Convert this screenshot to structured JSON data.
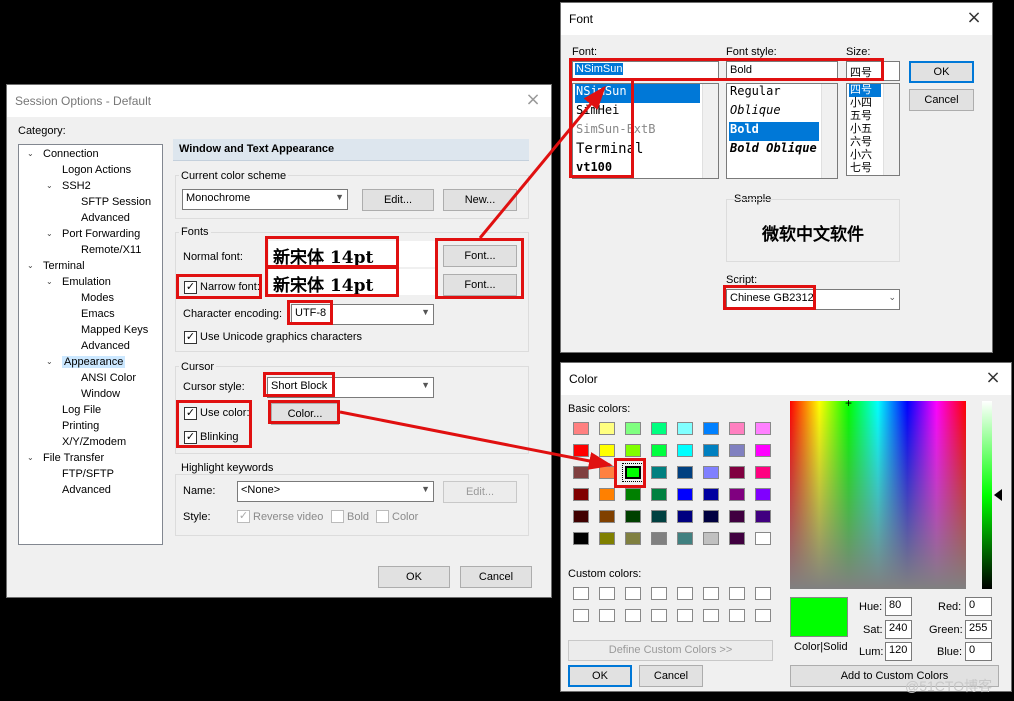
{
  "session": {
    "title": "Session Options - Default",
    "category_label": "Category:",
    "tree": [
      {
        "label": "Connection",
        "exp": "⌄",
        "expand": true
      },
      {
        "label": "Logon Actions"
      },
      {
        "label": "SSH2",
        "exp": "⌄",
        "expand": true
      },
      {
        "label": "SFTP Session"
      },
      {
        "label": "Advanced"
      },
      {
        "label": "Port Forwarding",
        "exp": "⌄",
        "expand": true
      },
      {
        "label": "Remote/X11"
      },
      {
        "label": "Terminal",
        "exp": "⌄",
        "expand": true
      },
      {
        "label": "Emulation",
        "exp": "⌄",
        "expand": true
      },
      {
        "label": "Modes"
      },
      {
        "label": "Emacs"
      },
      {
        "label": "Mapped Keys"
      },
      {
        "label": "Advanced"
      },
      {
        "label": "Appearance",
        "exp": "⌄",
        "expand": true,
        "selected": true
      },
      {
        "label": "ANSI Color"
      },
      {
        "label": "Window"
      },
      {
        "label": "Log File"
      },
      {
        "label": "Printing"
      },
      {
        "label": "X/Y/Zmodem"
      },
      {
        "label": "File Transfer",
        "exp": "⌄",
        "expand": true
      },
      {
        "label": "FTP/SFTP"
      },
      {
        "label": "Advanced"
      }
    ],
    "section_header": "Window and Text Appearance",
    "color_scheme_label": "Current color scheme",
    "color_scheme_value": "Monochrome",
    "edit_label": "Edit...",
    "new_label": "New...",
    "fonts_label": "Fonts",
    "normal_font_label": "Normal font:",
    "normal_font_preview": "新宋体  14pt",
    "narrow_font_label": "Narrow font:",
    "narrow_font_preview": "新宋体  14pt",
    "font_btn": "Font...",
    "encoding_label": "Character encoding:",
    "encoding_value": "UTF-8",
    "unicode_label": "Use Unicode graphics characters",
    "cursor_label": "Cursor",
    "cursor_style_label": "Cursor style:",
    "cursor_style_value": "Short Block",
    "use_color_label": "Use color:",
    "color_btn": "Color...",
    "blinking_label": "Blinking",
    "highlight_label": "Highlight keywords",
    "name_label": "Name:",
    "name_value": "<None>",
    "style_label": "Style:",
    "reverse_label": "Reverse video",
    "bold_label": "Bold",
    "color_label": "Color",
    "ok": "OK",
    "cancel": "Cancel",
    "check_mark": "✓"
  },
  "font_dialog": {
    "title": "Font",
    "font_label": "Font:",
    "style_label": "Font style:",
    "size_label": "Size:",
    "font_value": "NSimSun",
    "style_value": "Bold",
    "size_value": "四号",
    "fonts": [
      "NSimSun",
      "SimHei",
      "SimSun-ExtB",
      "Terminal",
      "vt100"
    ],
    "styles": [
      "Regular",
      "Oblique",
      "Bold",
      "Bold Oblique"
    ],
    "sizes": [
      "四号",
      "小四",
      "五号",
      "小五",
      "六号",
      "小六",
      "七号"
    ],
    "sample_label": "Sample",
    "sample_text": "微软中文软件",
    "script_label": "Script:",
    "script_value": "Chinese GB2312",
    "ok": "OK",
    "cancel": "Cancel"
  },
  "color_dialog": {
    "title": "Color",
    "basic_label": "Basic colors:",
    "custom_label": "Custom colors:",
    "define_btn": "Define Custom Colors >>",
    "ok": "OK",
    "cancel": "Cancel",
    "add_btn": "Add to Custom Colors",
    "color_solid_label": "Color|Solid",
    "hue_label": "Hue:",
    "hue": "80",
    "sat_label": "Sat:",
    "sat": "240",
    "lum_label": "Lum:",
    "lum": "120",
    "red_label": "Red:",
    "red": "0",
    "green_label": "Green:",
    "green": "255",
    "blue_label": "Blue:",
    "blue": "0",
    "selected_color": "#00ff00",
    "basic_colors": [
      [
        "#ff8080",
        "#ffff80",
        "#80ff80",
        "#00ff80",
        "#80ffff",
        "#0080ff",
        "#ff80c0",
        "#ff80ff"
      ],
      [
        "#ff0000",
        "#ffff00",
        "#80ff00",
        "#00ff40",
        "#00ffff",
        "#0080c0",
        "#8080c0",
        "#ff00ff"
      ],
      [
        "#804040",
        "#ff8040",
        "#00ff00",
        "#008080",
        "#004080",
        "#8080ff",
        "#800040",
        "#ff0080"
      ],
      [
        "#800000",
        "#ff8000",
        "#008000",
        "#008040",
        "#0000ff",
        "#0000a0",
        "#800080",
        "#8000ff"
      ],
      [
        "#400000",
        "#804000",
        "#004000",
        "#004040",
        "#000080",
        "#000040",
        "#400040",
        "#400080"
      ],
      [
        "#000000",
        "#808000",
        "#808040",
        "#808080",
        "#408080",
        "#c0c0c0",
        "#400040",
        "#ffffff"
      ]
    ]
  },
  "watermark": "@51CTO博客"
}
